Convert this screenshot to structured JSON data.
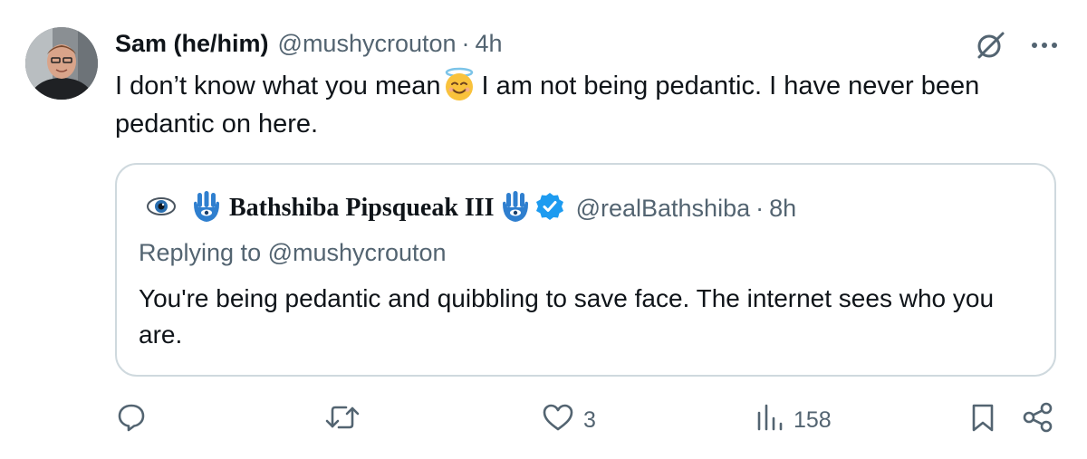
{
  "tweet": {
    "display_name": "Sam (he/him)",
    "handle": "@mushycrouton",
    "dot": "·",
    "time": "4h",
    "text_before_emoji": "I don’t know what you mean",
    "text_after_emoji": "I am not being pedantic. I have never been pedantic on here."
  },
  "quote": {
    "display_name": "Bathshiba Pipsqueak III",
    "handle": "@realBathshiba",
    "dot": "·",
    "time": "8h",
    "replying_to": "Replying to @mushycrouton",
    "text": "You're being pedantic and quibbling to save face. The internet sees who you are."
  },
  "actions": {
    "reply_count": "",
    "retweet_count": "",
    "like_count": "3",
    "view_count": "158"
  },
  "colors": {
    "text_primary": "#0f1419",
    "text_secondary": "#536471",
    "border": "#cfd9de",
    "verified_blue": "#1d9bf0"
  },
  "icons": {
    "top_right": [
      "grok-icon",
      "more-icon"
    ],
    "quote_header": [
      "eye-icon",
      "hamsa-icon",
      "hamsa-icon",
      "verified-badge-icon"
    ],
    "emoji": "smiling-face-with-halo-emoji",
    "action_bar": [
      "reply-icon",
      "retweet-icon",
      "like-icon",
      "views-icon",
      "bookmark-icon",
      "share-icon"
    ]
  }
}
